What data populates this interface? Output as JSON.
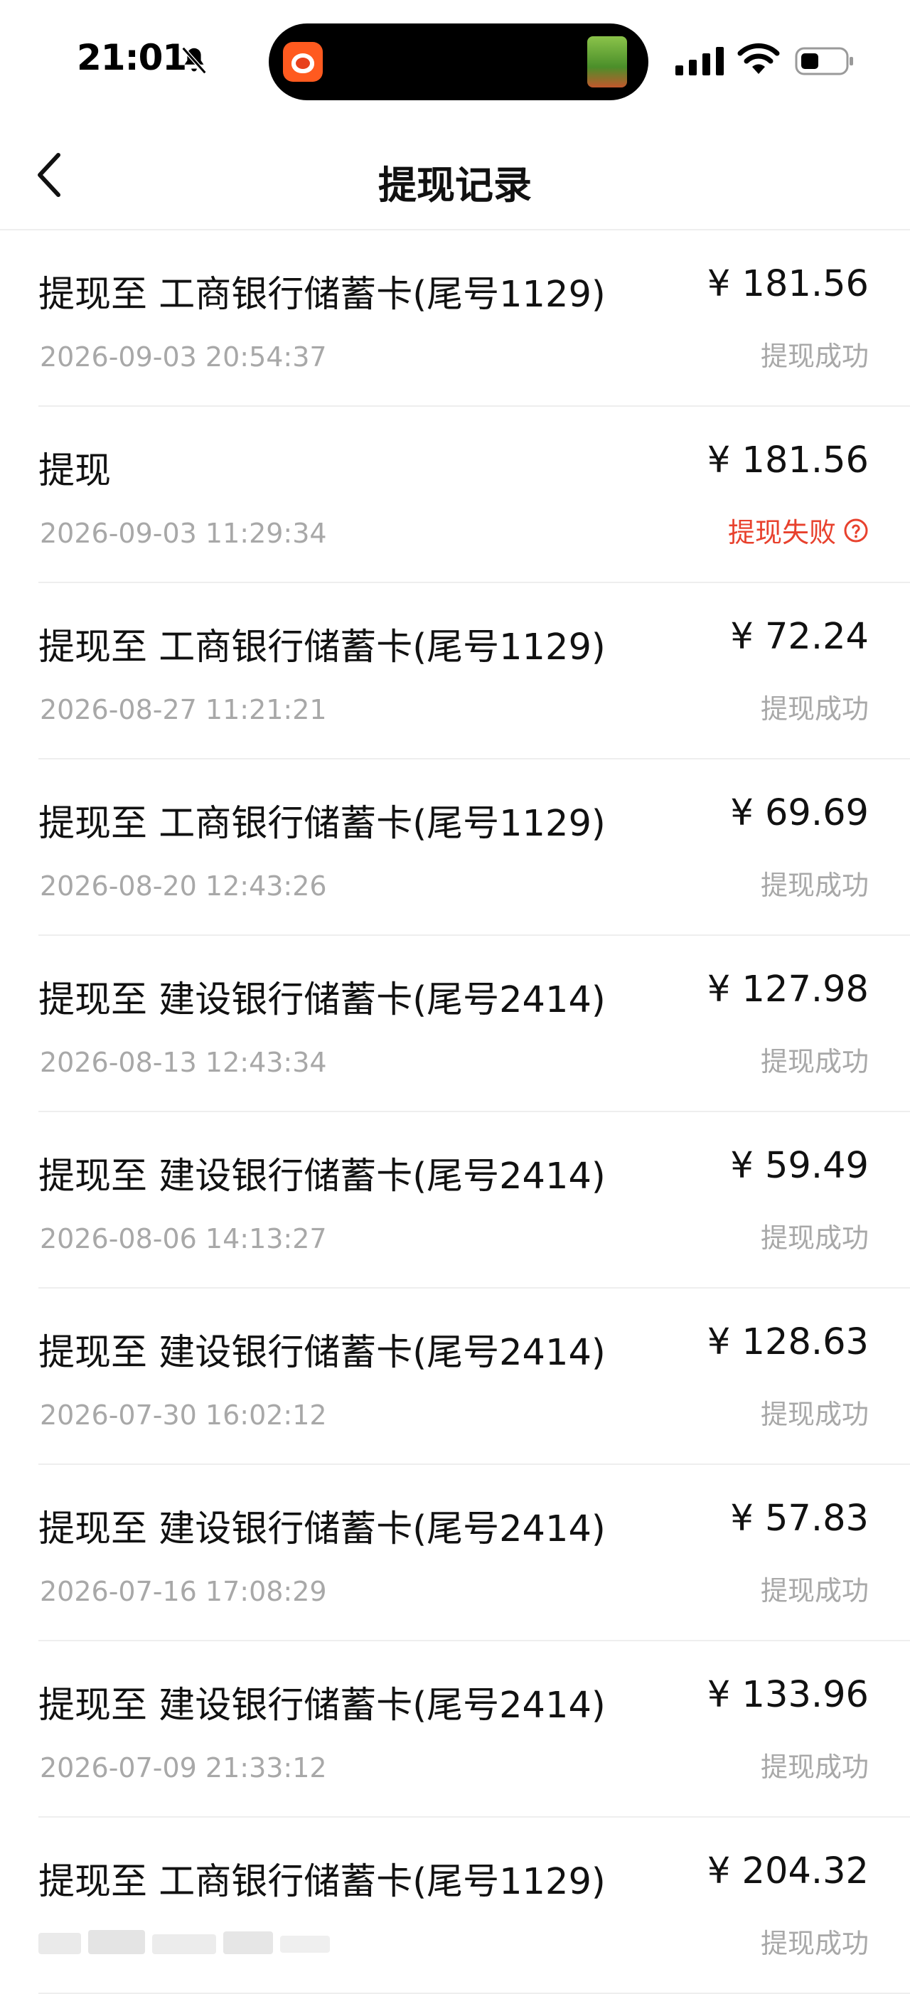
{
  "status_bar": {
    "time": "21:01"
  },
  "header": {
    "title": "提现记录"
  },
  "records": [
    {
      "title": "提现至 工商银行储蓄卡(尾号1129)",
      "time": "2026-09-03 20:54:37",
      "amount": "¥ 181.56",
      "status": "提现成功"
    },
    {
      "title": "提现",
      "time": "2026-09-03 11:29:34",
      "amount": "¥ 181.56",
      "status": "提现失败"
    },
    {
      "title": "提现至 工商银行储蓄卡(尾号1129)",
      "time": "2026-08-27 11:21:21",
      "amount": "¥ 72.24",
      "status": "提现成功"
    },
    {
      "title": "提现至 工商银行储蓄卡(尾号1129)",
      "time": "2026-08-20 12:43:26",
      "amount": "¥ 69.69",
      "status": "提现成功"
    },
    {
      "title": "提现至 建设银行储蓄卡(尾号2414)",
      "time": "2026-08-13 12:43:34",
      "amount": "¥ 127.98",
      "status": "提现成功"
    },
    {
      "title": "提现至 建设银行储蓄卡(尾号2414)",
      "time": "2026-08-06 14:13:27",
      "amount": "¥ 59.49",
      "status": "提现成功"
    },
    {
      "title": "提现至 建设银行储蓄卡(尾号2414)",
      "time": "2026-07-30 16:02:12",
      "amount": "¥ 128.63",
      "status": "提现成功"
    },
    {
      "title": "提现至 建设银行储蓄卡(尾号2414)",
      "time": "2026-07-16 17:08:29",
      "amount": "¥ 57.83",
      "status": "提现成功"
    },
    {
      "title": "提现至 建设银行储蓄卡(尾号2414)",
      "time": "2026-07-09 21:33:12",
      "amount": "¥ 133.96",
      "status": "提现成功"
    },
    {
      "title": "提现至 工商银行储蓄卡(尾号1129)",
      "time": "",
      "amount": "¥ 204.32",
      "status": "提现成功"
    }
  ],
  "colors": {
    "text_primary": "#111111",
    "text_secondary": "#a8a8a8",
    "status_failed": "#e8412d",
    "divider": "#eeeeee"
  },
  "icons": {
    "back": "chevron-left-icon",
    "help": "question-circle-icon",
    "bell_off": "bell-slash-icon",
    "signal": "signal-bars-icon",
    "wifi": "wifi-icon",
    "battery": "battery-icon"
  }
}
